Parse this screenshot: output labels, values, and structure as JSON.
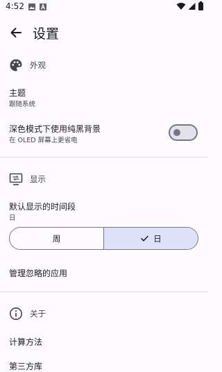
{
  "status_bar": {
    "time": "4:52",
    "left_icons": [
      "gallery-icon",
      "text-a-icon"
    ],
    "right_icons": [
      "wifi-icon",
      "signal-icon",
      "battery-icon"
    ]
  },
  "top_bar": {
    "title": "设置",
    "back_icon": "arrow-back-icon"
  },
  "sections": {
    "appearance": {
      "label": "外观",
      "icon": "palette-icon"
    },
    "display": {
      "label": "显示",
      "icon": "display-icon"
    },
    "about": {
      "label": "关于",
      "icon": "info-icon"
    }
  },
  "prefs": {
    "theme": {
      "title": "主题",
      "summary": "跟随系统"
    },
    "black_bg": {
      "title": "深色模式下使用纯黑背景",
      "summary": "在 OLED 屏幕上更省电",
      "enabled": false
    },
    "default_period": {
      "title": "默认显示的时间段",
      "summary": "日",
      "options": [
        "周",
        "日"
      ],
      "selected": "日"
    },
    "ignored_apps": {
      "title": "管理忽略的应用"
    },
    "calc_method": {
      "title": "计算方法"
    },
    "third_party": {
      "title": "第三方库"
    }
  },
  "colors": {
    "background": "#fdfbff",
    "selected_segment": "#dde1f9",
    "outline": "#767680",
    "text": "#1b1b1f"
  }
}
